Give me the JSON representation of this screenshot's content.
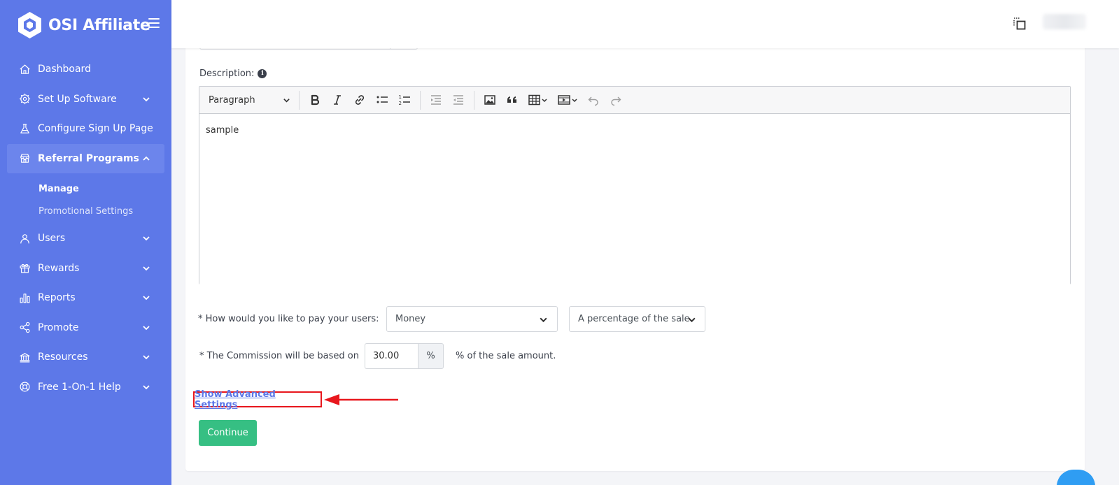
{
  "brand": {
    "name": "OSI Affiliate"
  },
  "sidebar": {
    "items": [
      {
        "label": "Dashboard",
        "icon": "home-icon",
        "has_chevron": false
      },
      {
        "label": "Set Up Software",
        "icon": "gear-icon",
        "has_chevron": true
      },
      {
        "label": "Configure Sign Up Page",
        "icon": "flask-icon",
        "has_chevron": false
      },
      {
        "label": "Referral Programs",
        "icon": "store-icon",
        "has_chevron": true,
        "active": true,
        "children": [
          {
            "label": "Manage",
            "current": true
          },
          {
            "label": "Promotional Settings",
            "current": false
          }
        ]
      },
      {
        "label": "Users",
        "icon": "user-icon",
        "has_chevron": true
      },
      {
        "label": "Rewards",
        "icon": "gift-icon",
        "has_chevron": true
      },
      {
        "label": "Reports",
        "icon": "bar-chart-icon",
        "has_chevron": true
      },
      {
        "label": "Promote",
        "icon": "share-icon",
        "has_chevron": true
      },
      {
        "label": "Resources",
        "icon": "bank-icon",
        "has_chevron": true
      },
      {
        "label": "Free 1-On-1 Help",
        "icon": "lifebuoy-icon",
        "has_chevron": true
      }
    ]
  },
  "form": {
    "description_label": "Description:",
    "editor": {
      "block_format": "Paragraph",
      "content": "sample",
      "toolbar_icons": [
        "bold-icon",
        "italic-icon",
        "link-icon",
        "bulleted-list-icon",
        "numbered-list-icon",
        "outdent-icon",
        "indent-icon",
        "image-icon",
        "quote-icon",
        "table-icon",
        "media-icon",
        "undo-icon",
        "redo-icon"
      ]
    },
    "pay_label": "* How would you like to pay your users:",
    "pay_method": "Money",
    "pay_type": "A percentage of the sale",
    "commission_label": "* The Commission will be based on",
    "commission_value": "30.00",
    "commission_suffix": "%",
    "commission_after": "% of the sale amount.",
    "advanced_link": "Show Advanced Settings",
    "continue_label": "Continue"
  },
  "colors": {
    "sidebar": "#5d78e8",
    "accent": "#5d78e8",
    "continue": "#36bf83",
    "annotation": "#e8171d"
  }
}
